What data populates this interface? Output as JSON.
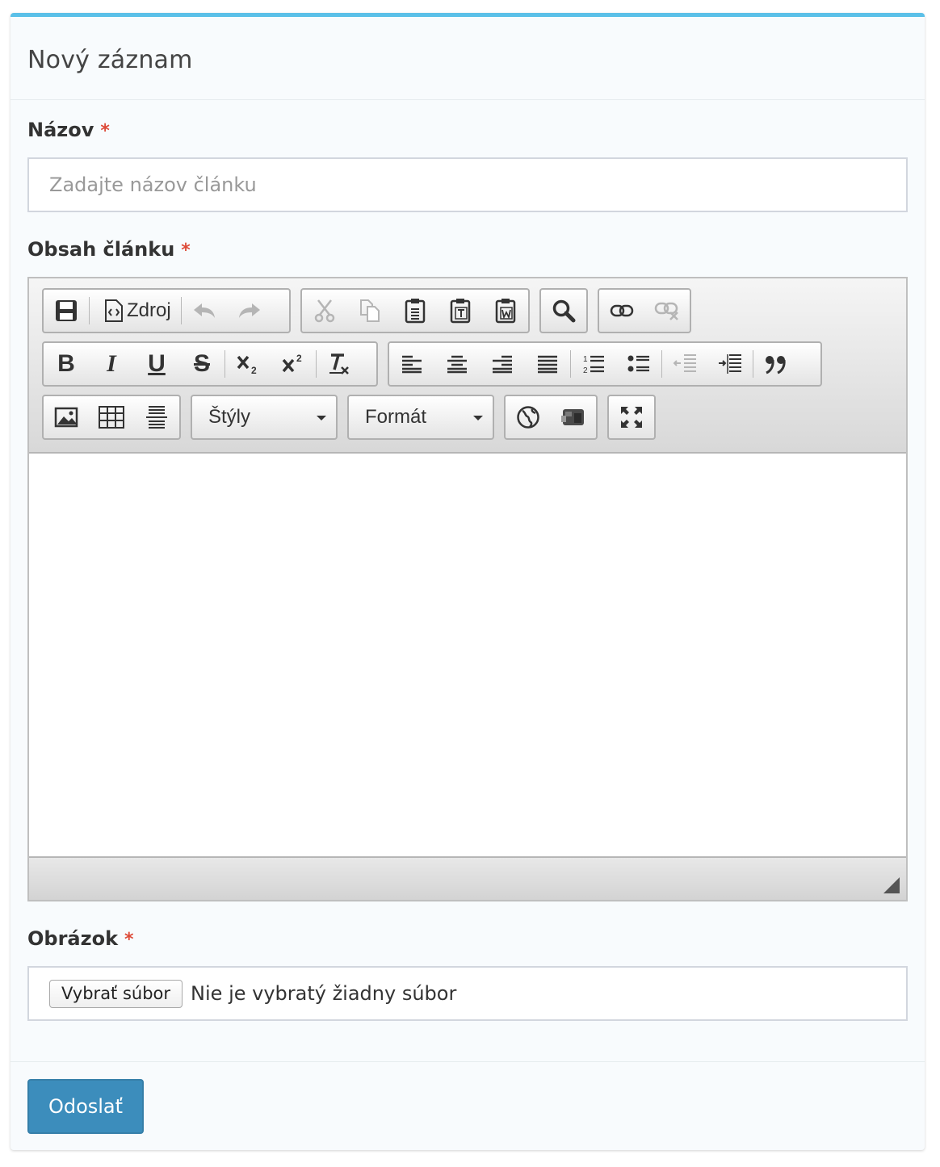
{
  "header": {
    "title": "Nový záznam"
  },
  "fields": {
    "title_label": "Názov",
    "title_placeholder": "Zadajte názov článku",
    "content_label": "Obsah článku",
    "image_label": "Obrázok",
    "required_mark": "*"
  },
  "editor": {
    "source_label": "Zdroj",
    "styles_label": "Štýly",
    "format_label": "Formát",
    "bold_letter": "B",
    "italic_letter": "I",
    "underline_letter": "U",
    "strike_letter": "S"
  },
  "file": {
    "button_label": "Vybrať súbor",
    "status_text": "Nie je vybratý žiadny súbor"
  },
  "footer": {
    "submit_label": "Odoslať"
  },
  "colors": {
    "accent_top": "#5bc0e8",
    "primary_button": "#3c8dbc",
    "required": "#dd4b39"
  }
}
